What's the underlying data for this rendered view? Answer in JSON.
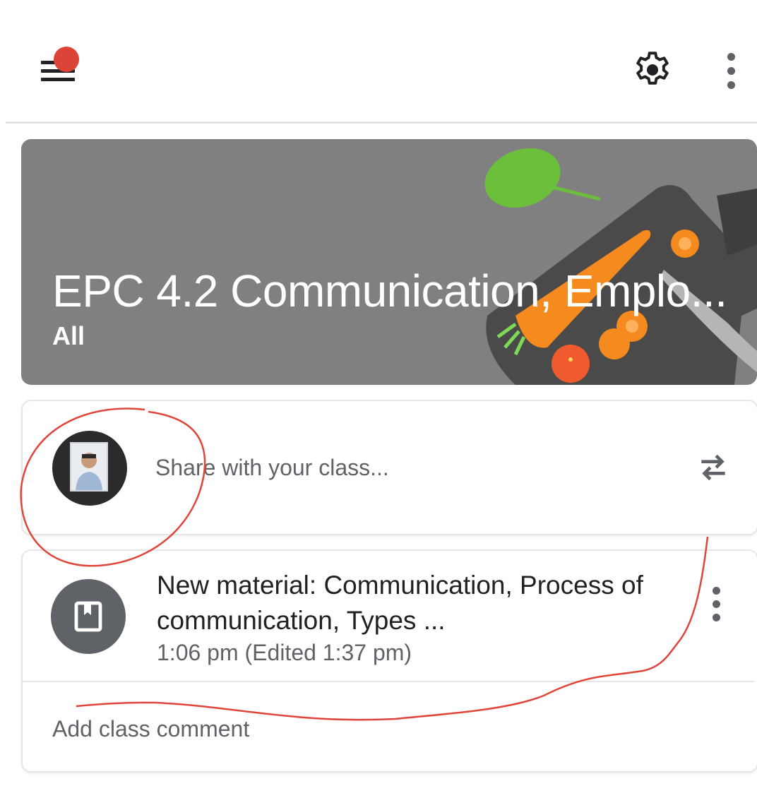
{
  "topbar": {
    "menu_icon": "menu-icon",
    "notification_color": "#db4437",
    "settings_icon": "gear-icon",
    "more_icon": "more-vert-icon"
  },
  "class_banner": {
    "title": "EPC 4.2 Communication, Emplo...",
    "section": "All",
    "background_color": "#808080"
  },
  "share": {
    "placeholder": "Share with your class...",
    "avatar_icon": "profile-photo",
    "action_icon": "repost-icon"
  },
  "post": {
    "icon": "book-icon",
    "title": "New material: Communication, Process of communication,  Types ...",
    "time": "1:06 pm (Edited 1:37 pm)",
    "more_icon": "more-vert-icon",
    "comment_placeholder": "Add class comment"
  },
  "annotation_color": "#e0453a"
}
